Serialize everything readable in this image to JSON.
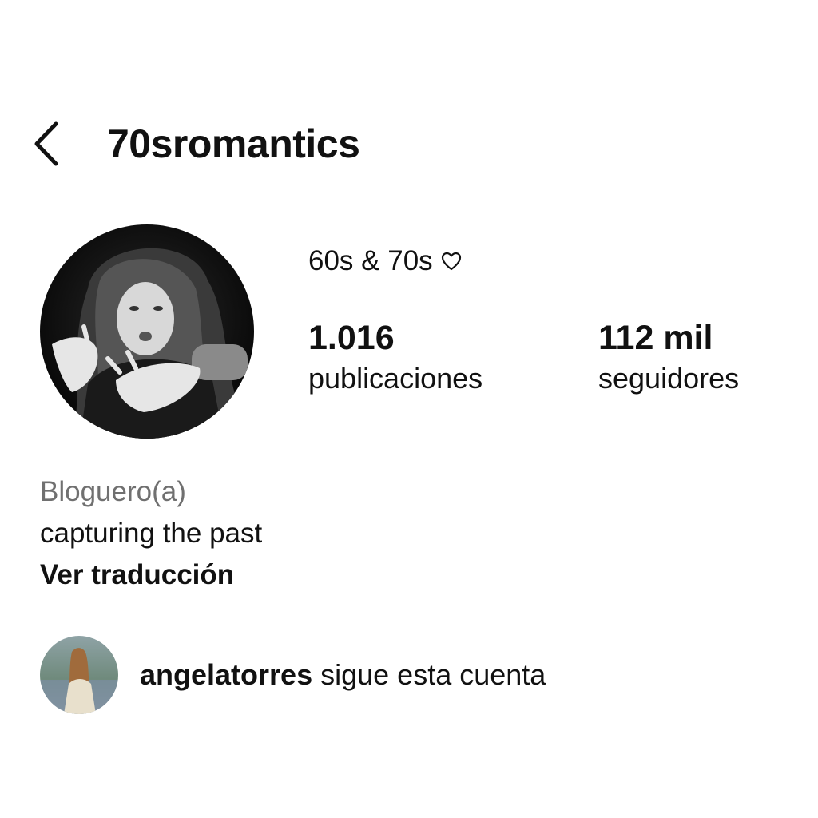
{
  "header": {
    "back_icon": "chevron-left-icon",
    "username": "70sromantics"
  },
  "profile": {
    "avatar_icon": "profile-photo",
    "display_name": "60s & 70s",
    "display_name_icon": "heart-outline-icon",
    "stats": {
      "posts_value": "1.016",
      "posts_label": "publicaciones",
      "followers_value": "112 mil",
      "followers_label": "seguidores"
    }
  },
  "bio": {
    "category": "Bloguero(a)",
    "text": "capturing the past",
    "translate_label": "Ver traducción"
  },
  "followed_by": {
    "avatar_icon": "follower-avatar",
    "username": "angelatorres",
    "text": "sigue esta cuenta"
  },
  "colors": {
    "text_primary": "#111111",
    "text_secondary": "#707070",
    "background": "#ffffff"
  }
}
